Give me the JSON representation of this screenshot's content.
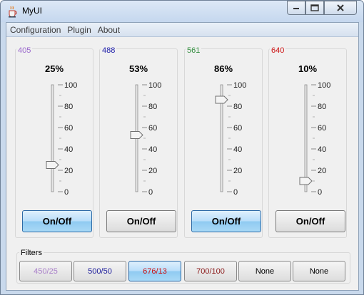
{
  "window": {
    "title": "MyUI",
    "icon": "java-cup-icon",
    "controls": [
      "minimize-icon",
      "maximize-icon",
      "close-icon"
    ]
  },
  "menu": [
    "Configuration",
    "Plugin",
    "About"
  ],
  "channels": [
    {
      "wavelength": "405",
      "color": "#9966cc",
      "percent_label": "25%",
      "value": 25,
      "button": "On/Off",
      "on": true
    },
    {
      "wavelength": "488",
      "color": "#1a1aa8",
      "percent_label": "53%",
      "value": 53,
      "button": "On/Off",
      "on": false
    },
    {
      "wavelength": "561",
      "color": "#2e8b3a",
      "percent_label": "86%",
      "value": 86,
      "button": "On/Off",
      "on": true
    },
    {
      "wavelength": "640",
      "color": "#cc1111",
      "percent_label": "10%",
      "value": 10,
      "button": "On/Off",
      "on": false
    }
  ],
  "slider_ticks": [
    "100",
    "80",
    "60",
    "40",
    "20",
    "0"
  ],
  "filters": {
    "label": "Filters",
    "buttons": [
      {
        "label": "450/25",
        "color": "#a97fc9",
        "selected": false
      },
      {
        "label": "500/50",
        "color": "#1a1a9a",
        "selected": false
      },
      {
        "label": "676/13",
        "color": "#cc1111",
        "selected": true
      },
      {
        "label": "700/100",
        "color": "#8b1a1a",
        "selected": false
      },
      {
        "label": "None",
        "color": "#000000",
        "selected": false
      },
      {
        "label": "None",
        "color": "#000000",
        "selected": false
      }
    ]
  }
}
